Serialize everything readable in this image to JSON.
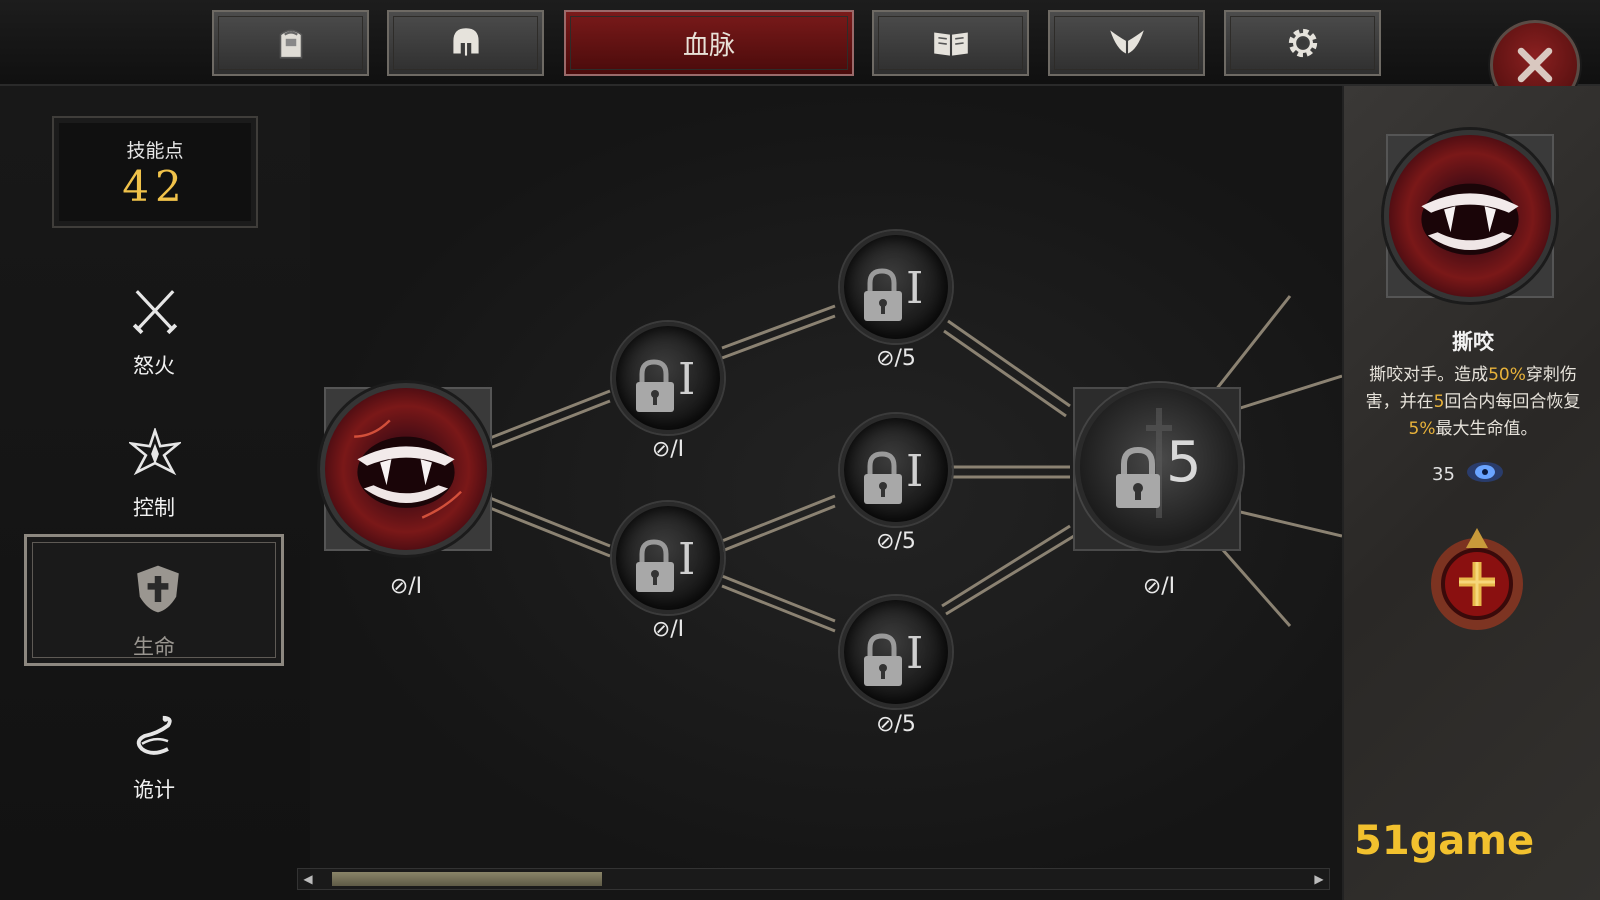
{
  "top_tabs": [
    {
      "name": "inventory",
      "icon": "backpack-icon"
    },
    {
      "name": "equipment",
      "icon": "helmet-icon"
    },
    {
      "name": "bloodline",
      "label": "血脉",
      "active": true
    },
    {
      "name": "codex",
      "icon": "open-book-icon"
    },
    {
      "name": "wings",
      "icon": "wings-icon"
    },
    {
      "name": "settings",
      "icon": "gear-icon"
    }
  ],
  "close_icon": "close-icon",
  "skill_points": {
    "label": "技能点",
    "value": "42"
  },
  "categories": [
    {
      "label": "怒火",
      "icon": "crossed-swords-icon",
      "active": false
    },
    {
      "label": "控制",
      "icon": "star-burst-icon",
      "active": false
    },
    {
      "label": "生命",
      "icon": "shield-cross-icon",
      "active": true
    },
    {
      "label": "诡计",
      "icon": "serpent-icon",
      "active": false
    }
  ],
  "tree": {
    "start": {
      "caption": "⊘/I",
      "icon": "fangs-icon"
    },
    "tier1": [
      {
        "caption": "⊘/I",
        "roman": "I",
        "locked": true
      },
      {
        "caption": "⊘/I",
        "roman": "I",
        "locked": true
      }
    ],
    "tier2": [
      {
        "caption": "⊘/5",
        "roman": "I",
        "locked": true
      },
      {
        "caption": "⊘/5",
        "roman": "I",
        "locked": true
      },
      {
        "caption": "⊘/5",
        "roman": "I",
        "locked": true
      }
    ],
    "tier3": {
      "caption": "⊘/I",
      "number": "5",
      "locked": true
    }
  },
  "detail": {
    "name": "撕咬",
    "desc_parts": [
      "撕咬对手。造成",
      "50%",
      "穿刺伤害，并在",
      "5",
      "回合内每回合恢复",
      "5%",
      "最大生命值。"
    ],
    "cost": "35",
    "cost_icon": "blue-gem-icon",
    "emblem_icon": "blood-cross-emblem-icon"
  },
  "scrollbar": {
    "position_fraction": 0.0
  },
  "watermark": "51game",
  "colors": {
    "accent_gold": "#f0c24a",
    "active_tab": "#7a1a1a",
    "highlight_text": "#e8b23a"
  }
}
